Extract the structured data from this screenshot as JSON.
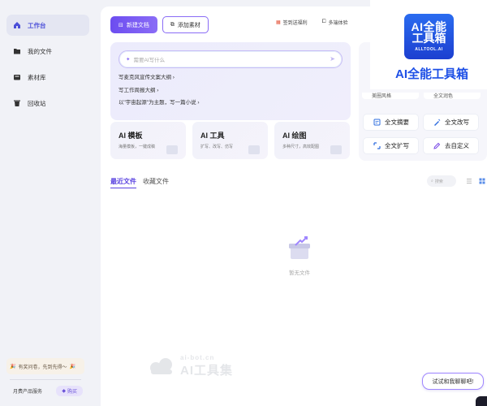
{
  "sidebar": {
    "items": [
      {
        "label": "工作台",
        "icon": "home-icon",
        "active": true
      },
      {
        "label": "我的文件",
        "icon": "folder-icon"
      },
      {
        "label": "素材库",
        "icon": "library-icon"
      },
      {
        "label": "回收站",
        "icon": "trash-icon"
      }
    ],
    "promo": "有奖问卷，先到先得～",
    "plan_label": "月费产品服务",
    "buy_label": "购买"
  },
  "toolbar": {
    "new_doc": "新建文档",
    "add_material": "添加素材",
    "links": [
      {
        "label": "签到送福利",
        "icon": "calendar-icon"
      },
      {
        "label": "多端体验",
        "icon": "devices-icon"
      }
    ]
  },
  "ai_write": {
    "placeholder": "需要AI写什么",
    "suggestions": [
      "写麦克风宣传文案大纲",
      "写工作周报大纲",
      "以\"宇宙起源\"为主题，写一篇小说"
    ]
  },
  "features": [
    {
      "title": "AI 模板",
      "desc": "海量模板，一键成稿"
    },
    {
      "title": "AI 工具",
      "desc": "扩写、改写、仿写"
    },
    {
      "title": "AI 绘图",
      "desc": "多种尺寸，高效配图"
    }
  ],
  "tools": {
    "partial_left": "美圈风格",
    "partial_right": "全文润色",
    "items": [
      {
        "label": "全文摘要",
        "icon": "summary-icon"
      },
      {
        "label": "全文改写",
        "icon": "rewrite-icon"
      },
      {
        "label": "全文扩写",
        "icon": "expand-icon"
      },
      {
        "label": "去自定义",
        "icon": "edit-icon"
      }
    ]
  },
  "files": {
    "tabs": [
      "最近文件",
      "收藏文件"
    ],
    "search_placeholder": "搜索",
    "empty_text": "暂无文件"
  },
  "watermark": {
    "domain": "ai-bot.cn",
    "name": "AI工具集"
  },
  "chat": {
    "label": "试试和我聊聊吧!"
  },
  "logo": {
    "line1": "AI全能",
    "line2": "工具箱",
    "line3": "ALLTOOL.AI",
    "caption": "AI全能工具箱"
  },
  "colors": {
    "accent": "#6c4df0",
    "logo_blue": "#1e50e6"
  }
}
